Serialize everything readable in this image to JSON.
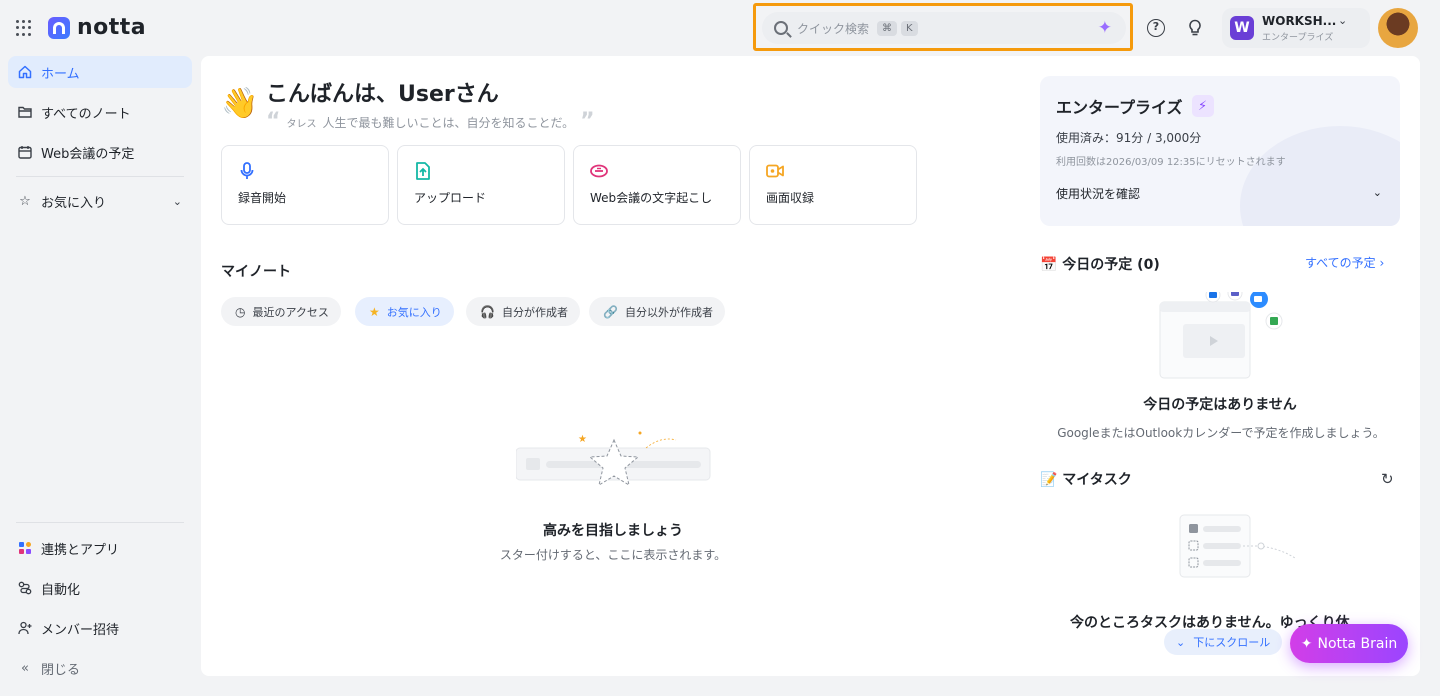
{
  "header": {
    "logo_text": "notta",
    "search_placeholder": "クイック検索",
    "shortcut_keys": [
      "⌘",
      "K"
    ],
    "workspace_initial": "W",
    "workspace_name": "WORKSH...",
    "workspace_plan": "エンタープライズ"
  },
  "sidebar": {
    "items": [
      {
        "label": "ホーム",
        "icon": "home-icon"
      },
      {
        "label": "すべてのノート",
        "icon": "folder-icon"
      },
      {
        "label": "Web会議の予定",
        "icon": "calendar-icon"
      },
      {
        "label": "お気に入り",
        "icon": "star-icon"
      }
    ],
    "bottom_items": [
      {
        "label": "連携とアプリ",
        "icon": "apps-icon"
      },
      {
        "label": "自動化",
        "icon": "automation-icon"
      },
      {
        "label": "メンバー招待",
        "icon": "add-member-icon"
      },
      {
        "label": "閉じる",
        "icon": "collapse-icon"
      }
    ]
  },
  "greeting": {
    "title": "こんばんは、Userさん",
    "quote_author": "タレス",
    "quote_text": "人生で最も難しいことは、自分を知ることだ。"
  },
  "actions": [
    {
      "label": "録音開始",
      "icon": "microphone-icon",
      "color": "#3370ff"
    },
    {
      "label": "アップロード",
      "icon": "upload-icon",
      "color": "#14b8a6"
    },
    {
      "label": "Web会議の文字起こし",
      "icon": "meeting-icon",
      "color": "#e0347a"
    },
    {
      "label": "画面収録",
      "icon": "screen-record-icon",
      "color": "#f5a623"
    }
  ],
  "notes": {
    "title": "マイノート",
    "filters": [
      "最近のアクセス",
      "お気に入り",
      "自分が作成者",
      "自分以外が作成者"
    ],
    "active_filter": "お気に入り",
    "empty_title": "高みを目指しましょう",
    "empty_subtitle": "スター付けすると、ここに表示されます。"
  },
  "enterprise": {
    "title": "エンタープライズ",
    "usage": "使用済み：91分 / 3,000分",
    "reset": "利用回数は2026/03/09 12:35にリセットされます",
    "check_label": "使用状況を確認"
  },
  "schedule": {
    "title": "📅 今日の予定 (0)",
    "link": "すべての予定",
    "empty_title": "今日の予定はありません",
    "empty_subtitle": "GoogleまたはOutlookカレンダーで予定を作成しましょう。"
  },
  "tasks": {
    "title": "📝 マイタスク",
    "empty_title": "今のところタスクはありません。ゆっくり休",
    "scroll_label": "下にスクロール"
  },
  "brain_button": "Notta Brain",
  "colors": {
    "accent": "#3370ff",
    "highlight": "#f59a0c",
    "brain": "#b040f0"
  }
}
